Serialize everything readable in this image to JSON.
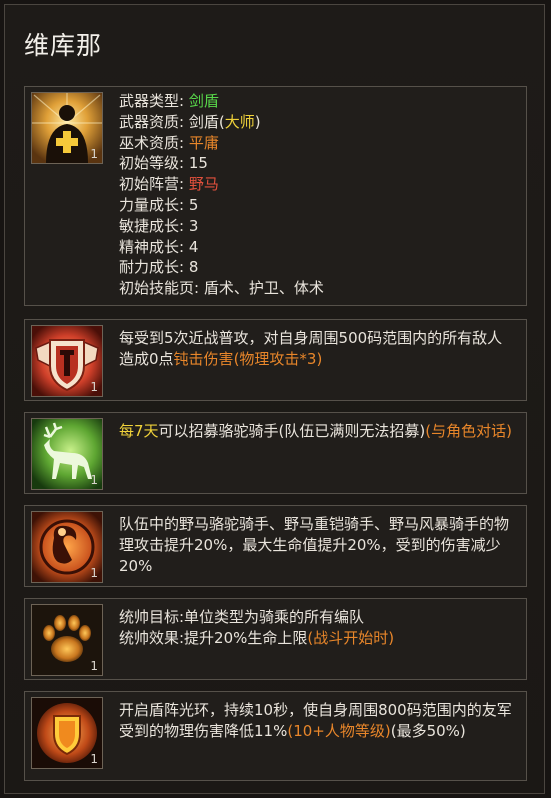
{
  "hero": {
    "name": "维库那"
  },
  "profile": {
    "level_badge": "1",
    "weapon_type_label": "武器类型:",
    "weapon_type_value": "剑盾",
    "weapon_quality_label": "武器资质:",
    "weapon_quality_value": "剑盾",
    "weapon_quality_open": "(",
    "weapon_quality_grade": "大师",
    "weapon_quality_close": ")",
    "sorcery_label": "巫术资质:",
    "sorcery_value": "平庸",
    "level_label": "初始等级:",
    "level_value": "15",
    "camp_label": "初始阵营:",
    "camp_value": "野马",
    "str_label": "力量成长:",
    "str_value": "5",
    "agi_label": "敏捷成长:",
    "agi_value": "3",
    "spi_label": "精神成长:",
    "spi_value": "4",
    "end_label": "耐力成长:",
    "end_value": "8",
    "skills_label": "初始技能页:",
    "skills_value": "盾术、护卫、体术"
  },
  "skills": [
    {
      "icon": "shield-wing-icon",
      "level": "1",
      "text_a": "每受到5次近战普攻，对自身周围500码范围内的所有敌人造成0点",
      "text_b": "钝击伤害",
      "text_c": "(物理攻击*3)"
    },
    {
      "icon": "deer-icon",
      "level": "1",
      "text_a": "每7天",
      "text_b": "可以招募骆驼骑手(队伍已满则无法招募)",
      "text_c": "(与角色对话)"
    },
    {
      "icon": "ram-head-icon",
      "level": "1",
      "text_a": "队伍中的野马骆驼骑手、野马重铠骑手、野马风暴骑手的物理攻击提升20%，最大生命值提升20%，受到的伤害减少20%"
    },
    {
      "icon": "paw-icon",
      "level": "1",
      "text_a": "统帅目标:单位类型为骑乘的所有编队",
      "text_b": "统帅效果:提升20%生命上限",
      "text_c": "(战斗开始时)"
    },
    {
      "icon": "shield-aura-icon",
      "level": "1",
      "text_a": "开启盾阵光环，持续10秒，使自身周围800码范围内的友军受到的物理伤害降低11%",
      "text_b": "(10+人物等级)",
      "text_c": "(最多50%)"
    }
  ],
  "colors": {
    "green": "#58d84a",
    "orange": "#e8862a",
    "red": "#e2503c",
    "yellow": "#f0d23a"
  }
}
